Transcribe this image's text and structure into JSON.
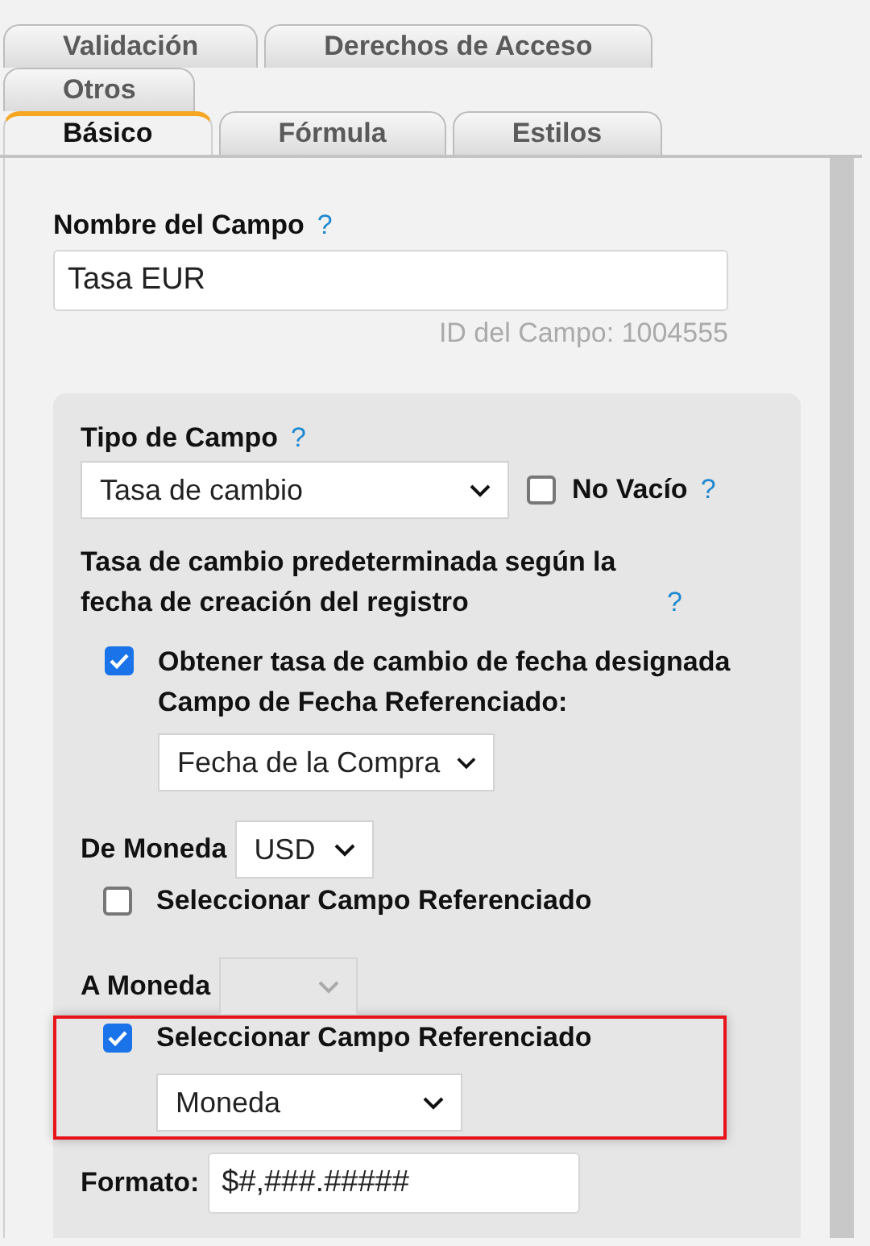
{
  "tab_rows": [
    {
      "tabs": [
        {
          "label": "Validación",
          "selected": false
        },
        {
          "label": "Derechos de Acceso",
          "selected": false
        }
      ]
    },
    {
      "tabs": [
        {
          "label": "Otros",
          "selected": false
        }
      ]
    },
    {
      "tabs": [
        {
          "label": "Básico",
          "selected": true
        },
        {
          "label": "Fórmula",
          "selected": false
        },
        {
          "label": "Estilos",
          "selected": false
        }
      ]
    }
  ],
  "field_name": {
    "label": "Nombre del Campo",
    "help": "?",
    "value": "Tasa EUR",
    "field_id": "ID del Campo: 1004555"
  },
  "field_type": {
    "label": "Tipo de Campo",
    "help": "?",
    "value": "Tasa de cambio"
  },
  "not_empty": {
    "label": "No Vacío",
    "checked": false,
    "help": "?"
  },
  "default_rate": {
    "heading": "Tasa de cambio predeterminada según la fecha de creación del registro",
    "help": "?"
  },
  "designated_date": {
    "checked": true,
    "label": "Obtener tasa de cambio de fecha designada",
    "sublabel": "Campo de Fecha Referenciado:",
    "value": "Fecha de la Compra"
  },
  "from_currency": {
    "label": "De Moneda",
    "value": "USD",
    "disabled": false,
    "reference": {
      "checked": false,
      "label": "Seleccionar Campo Referenciado",
      "highlighted": false
    }
  },
  "to_currency": {
    "label": "A Moneda",
    "disabled": true,
    "reference": {
      "checked": true,
      "label": "Seleccionar Campo Referenciado",
      "value": "Moneda",
      "highlighted": true
    }
  },
  "format": {
    "label": "Formato:",
    "value": "$#,###.#####"
  }
}
